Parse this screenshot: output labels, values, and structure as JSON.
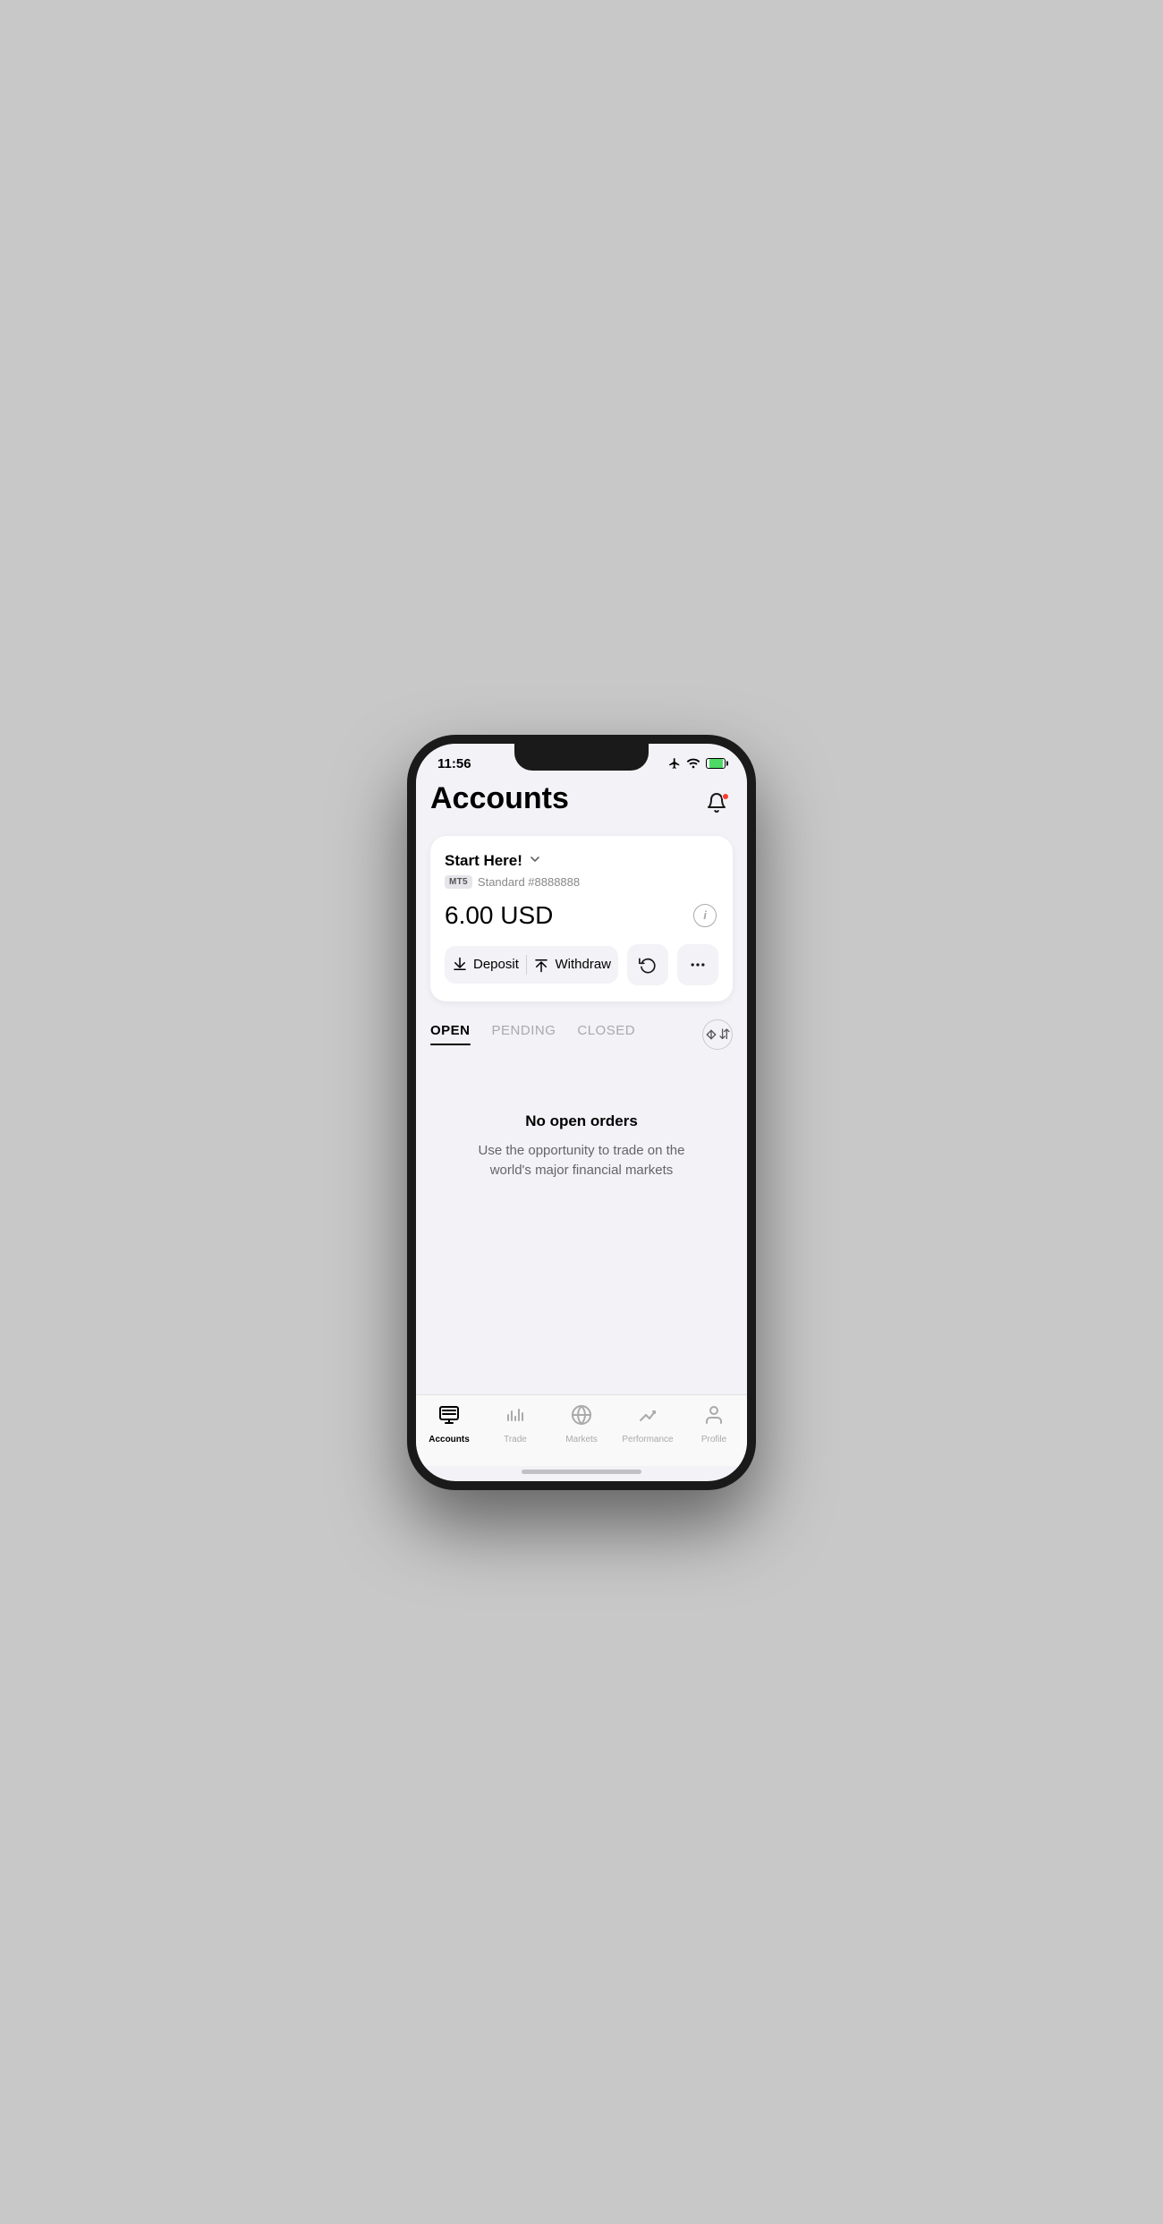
{
  "statusBar": {
    "time": "11:56",
    "icons": [
      "airplane",
      "wifi",
      "battery"
    ]
  },
  "header": {
    "title": "Accounts",
    "notificationIcon": "bell-icon"
  },
  "accountCard": {
    "accountName": "Start Here!",
    "badge": "MT5",
    "accountNumber": "Standard #8888888",
    "balance": "6.00 USD",
    "infoIcon": "i",
    "depositLabel": "Deposit",
    "withdrawLabel": "Withdraw",
    "historyIcon": "history",
    "moreIcon": "more"
  },
  "tabs": {
    "items": [
      {
        "label": "OPEN",
        "active": true
      },
      {
        "label": "PENDING",
        "active": false
      },
      {
        "label": "CLOSED",
        "active": false
      }
    ],
    "sortIcon": "sort"
  },
  "emptyState": {
    "title": "No open orders",
    "description": "Use the opportunity to trade on the world's major financial markets"
  },
  "bottomNav": {
    "items": [
      {
        "label": "Accounts",
        "icon": "accounts",
        "active": true
      },
      {
        "label": "Trade",
        "icon": "trade",
        "active": false
      },
      {
        "label": "Markets",
        "icon": "markets",
        "active": false
      },
      {
        "label": "Performance",
        "icon": "performance",
        "active": false
      },
      {
        "label": "Profile",
        "icon": "profile",
        "active": false
      }
    ]
  }
}
